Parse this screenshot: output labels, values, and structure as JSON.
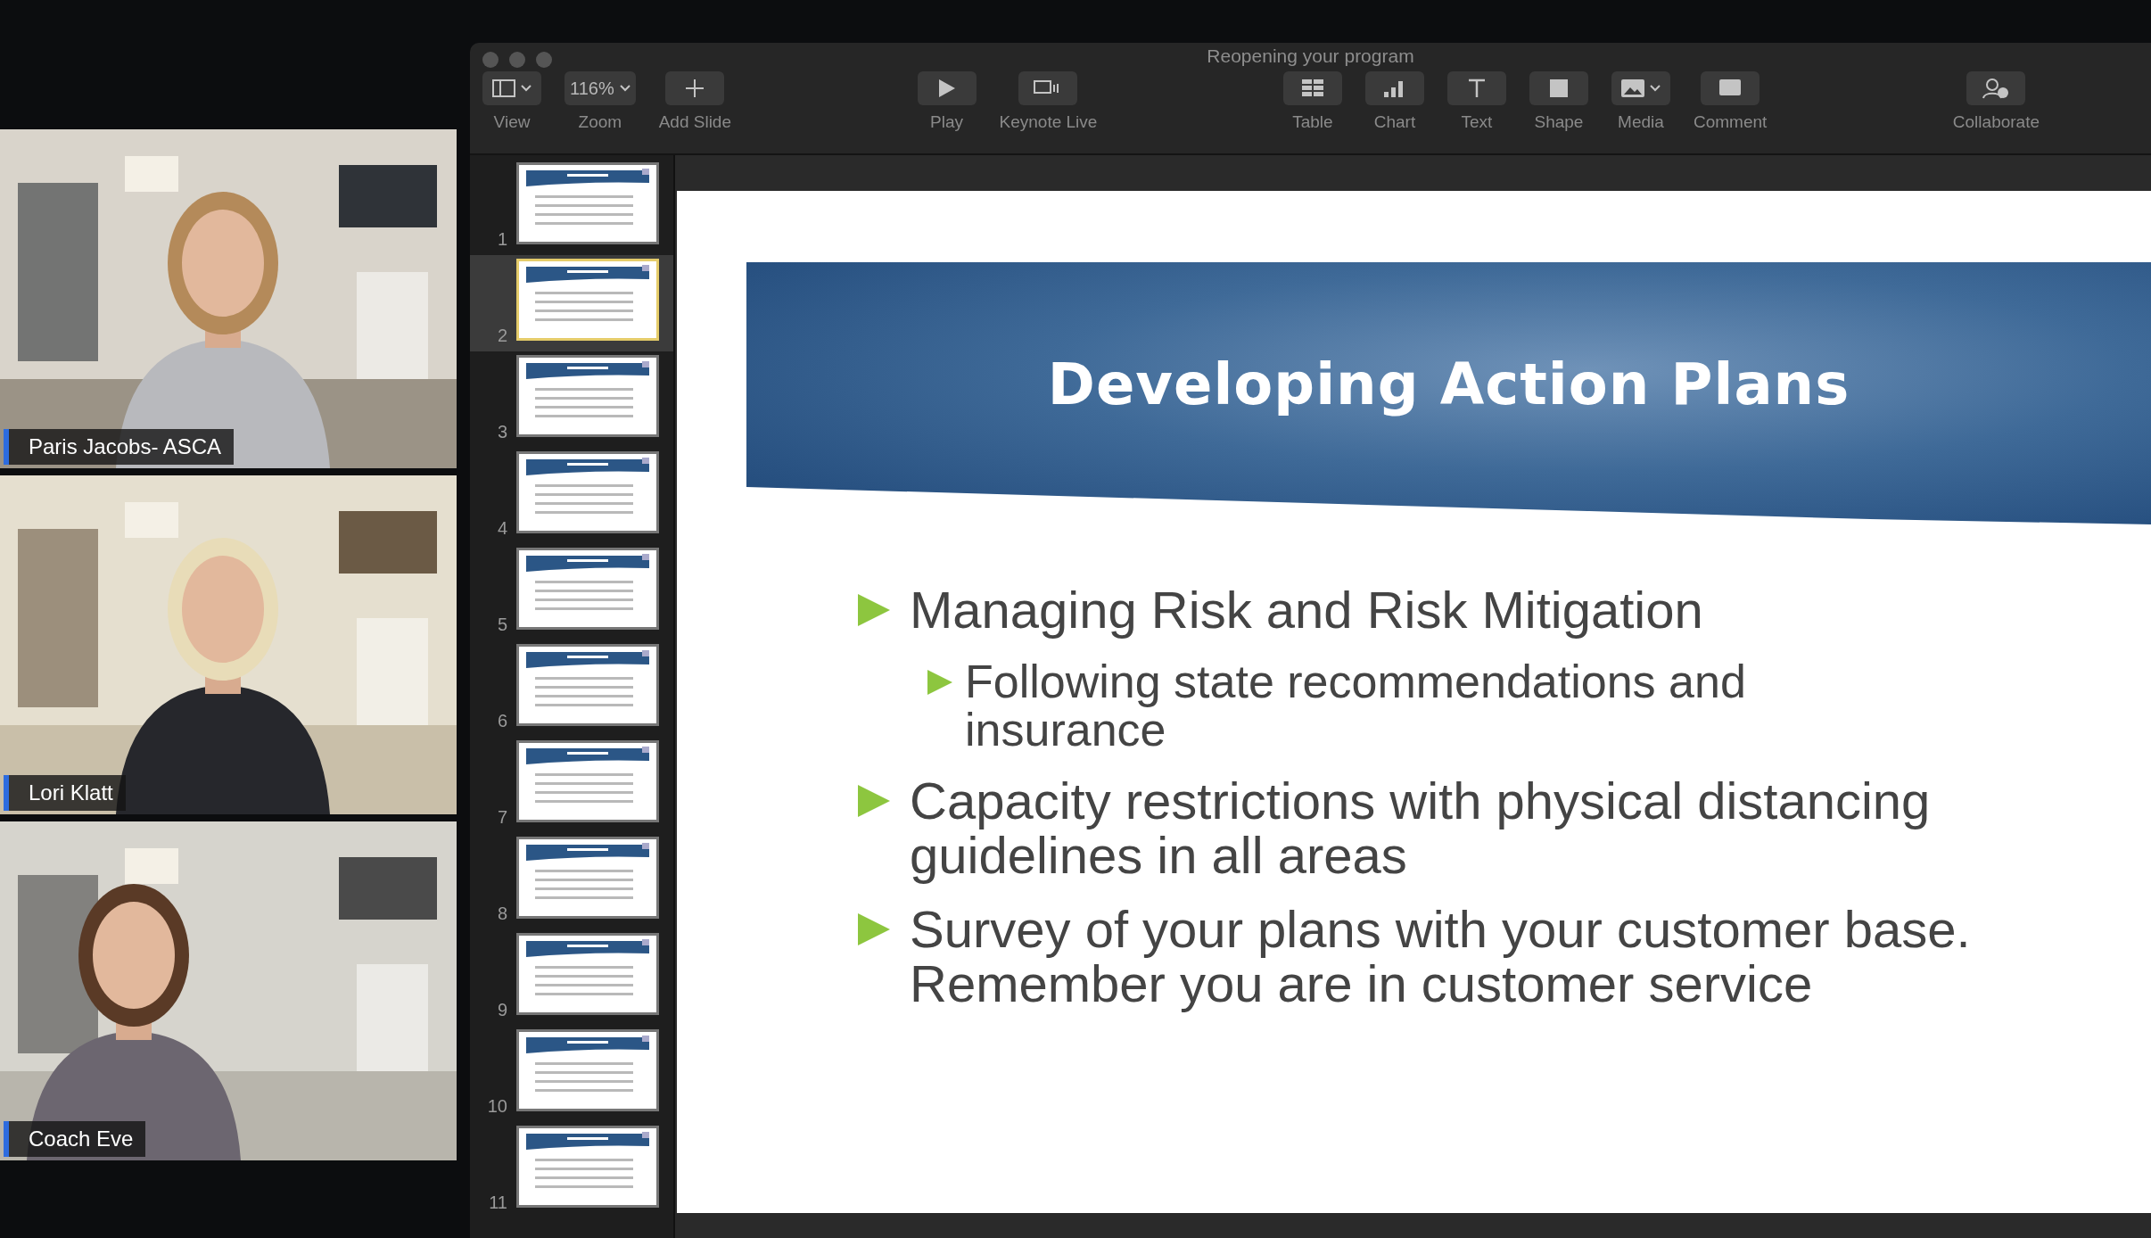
{
  "participants": [
    {
      "name": "Paris Jacobs- ASCA",
      "kind": "picture"
    },
    {
      "name": "Lori Klatt",
      "kind": "picture"
    },
    {
      "name": "Coach Eve",
      "kind": "picture"
    }
  ],
  "window": {
    "title": "Reopening your program"
  },
  "toolbar": {
    "groups": [
      [
        {
          "kind": "view",
          "label": "View"
        },
        {
          "kind": "zoom",
          "label": "Zoom",
          "value": "116%"
        },
        {
          "kind": "add",
          "label": "Add Slide"
        }
      ],
      [
        {
          "kind": "play",
          "label": "Play"
        },
        {
          "kind": "live",
          "label": "Keynote Live"
        }
      ],
      [
        {
          "kind": "table",
          "label": "Table"
        },
        {
          "kind": "chart",
          "label": "Chart"
        },
        {
          "kind": "text",
          "label": "Text"
        },
        {
          "kind": "shape",
          "label": "Shape"
        },
        {
          "kind": "media",
          "label": "Media"
        },
        {
          "kind": "comment",
          "label": "Comment"
        }
      ],
      [
        {
          "kind": "collaborate",
          "label": "Collaborate"
        }
      ]
    ]
  },
  "slides": [
    {
      "number": "1",
      "selected": false
    },
    {
      "number": "2",
      "selected": true
    },
    {
      "number": "3",
      "selected": false
    },
    {
      "number": "4",
      "selected": false
    },
    {
      "number": "5",
      "selected": false
    },
    {
      "number": "6",
      "selected": false
    },
    {
      "number": "7",
      "selected": false
    },
    {
      "number": "8",
      "selected": false
    },
    {
      "number": "9",
      "selected": false
    },
    {
      "number": "10",
      "selected": false
    },
    {
      "number": "11",
      "selected": false
    }
  ],
  "slide": {
    "title": "Developing Action Plans",
    "bullets": [
      {
        "text": "Managing Risk and Risk Mitigation",
        "children": [
          {
            "text": "Following state recommendations and insurance"
          }
        ]
      },
      {
        "text": "Capacity restrictions with physical distancing guidelines in all areas"
      },
      {
        "text": "Survey of your plans with your customer base. Remember you are in customer service"
      }
    ]
  }
}
